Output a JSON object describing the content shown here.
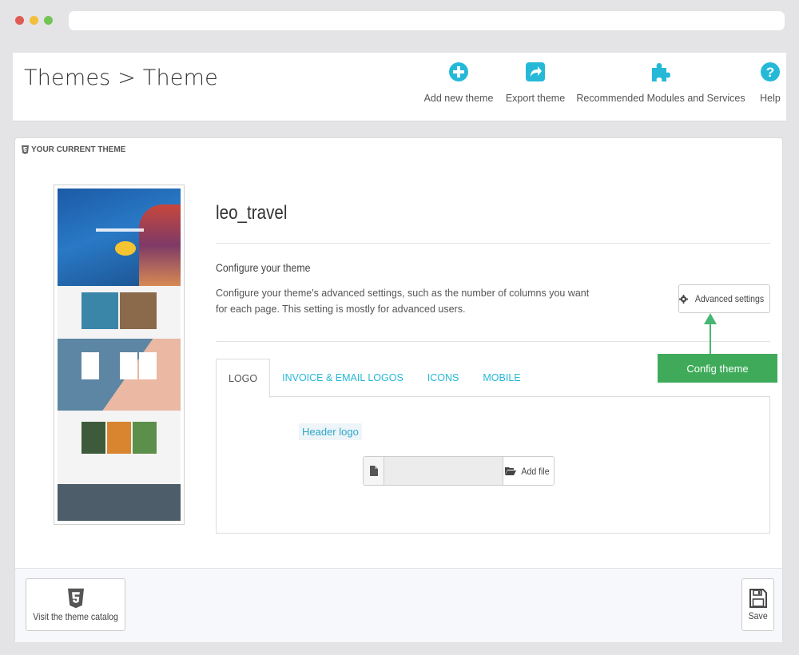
{
  "breadcrumb": "Themes > Theme",
  "toolbar": {
    "add_new_theme": "Add new theme",
    "export_theme": "Export theme",
    "recommended": "Recommended Modules and Services",
    "help": "Help"
  },
  "panel": {
    "heading": "YOUR CURRENT THEME",
    "theme_name": "leo_travel",
    "configure_title": "Configure your theme",
    "configure_desc": "Configure your theme's advanced settings, such as the number of columns you want for each page. This setting is mostly for advanced users.",
    "advanced_settings": "Advanced settings",
    "callout": "Config theme"
  },
  "tabs": [
    {
      "label": "LOGO",
      "active": true
    },
    {
      "label": "INVOICE & EMAIL LOGOS",
      "active": false
    },
    {
      "label": "ICONS",
      "active": false
    },
    {
      "label": "MOBILE",
      "active": false
    }
  ],
  "logo_tab": {
    "header_logo_label": "Header logo",
    "add_file": "Add file",
    "file_value": ""
  },
  "footer": {
    "catalog_label": "Visit the theme catalog",
    "save_label": "Save"
  },
  "colors": {
    "accent": "#25b9d7",
    "callout": "#3fab5a"
  },
  "icons": {
    "add_new_theme": "plus-circle-icon",
    "export_theme": "share-icon",
    "recommended": "puzzle-icon",
    "help": "question-circle-icon",
    "panel_heading": "html5-icon",
    "advanced_settings": "gear-icon",
    "file": "file-icon",
    "add_file": "folder-open-icon",
    "catalog": "html5-icon",
    "save": "floppy-disk-icon"
  }
}
